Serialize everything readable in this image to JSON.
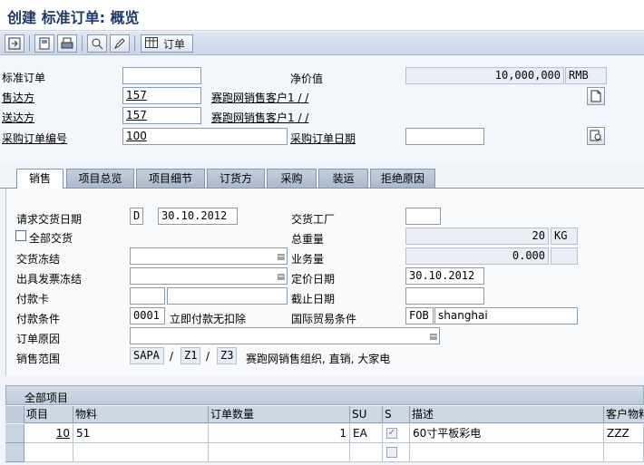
{
  "window": {
    "title": "创建 标准订单: 概览"
  },
  "toolbar": {
    "order_label": "订单"
  },
  "header": {
    "std_order_label": "标准订单",
    "std_order_value": "",
    "net_value_label": "净价值",
    "net_value": "10,000,000",
    "currency": "RMB",
    "sold_to_label": "售达方",
    "sold_to_value": "157",
    "sold_to_name": "赛跑网销售客户1 / /",
    "ship_to_label": "送达方",
    "ship_to_value": "157",
    "ship_to_name": "赛跑网销售客户1 / /",
    "po_number_label": "采购订单编号",
    "po_number_value": "100",
    "po_date_label": "采购订单日期",
    "po_date_value": ""
  },
  "tabs": [
    "销售",
    "项目总览",
    "项目细节",
    "订货方",
    "采购",
    "装运",
    "拒绝原因"
  ],
  "sales": {
    "req_delivery_date_label": "请求交货日期",
    "req_delivery_date_type": "D",
    "req_delivery_date": "30.10.2012",
    "delivery_plant_label": "交货工厂",
    "delivery_plant_value": "",
    "complete_delivery_label": "全部交货",
    "total_weight_label": "总重量",
    "total_weight": "20",
    "weight_unit": "KG",
    "delivery_block_label": "交货冻结",
    "volume_label": "业务量",
    "volume": "0.000",
    "billing_block_label": "出具发票冻结",
    "pricing_date_label": "定价日期",
    "pricing_date": "30.10.2012",
    "payment_card_label": "付款卡",
    "expiry_date_label": "截止日期",
    "payment_terms_label": "付款条件",
    "payment_terms_code": "0001",
    "payment_terms_text": "立即付款无扣除",
    "incoterms_label": "国际贸易条件",
    "incoterms_code": "FOB",
    "incoterms_place": "shanghai",
    "order_reason_label": "订单原因",
    "sales_area_label": "销售范围",
    "sales_org": "SAPA",
    "dist_channel": "Z1",
    "division": "Z3",
    "sep": "/",
    "sales_area_text": "赛跑网销售组织, 直销, 大家电"
  },
  "items": {
    "title": "全部项目",
    "columns": [
      "项目",
      "物料",
      "订单数量",
      "SU",
      "S",
      "描述",
      "客户物料"
    ],
    "rows": [
      {
        "item": "10",
        "material": "51",
        "qty": "1",
        "su": "EA",
        "desc": "60寸平板彩电",
        "cust_mat": "ZZZ"
      }
    ]
  },
  "icons": [
    "enter-icon",
    "save-icon",
    "print-icon",
    "find-icon",
    "edit-icon",
    "table-icon",
    "document-icon",
    "lookup-icon"
  ]
}
